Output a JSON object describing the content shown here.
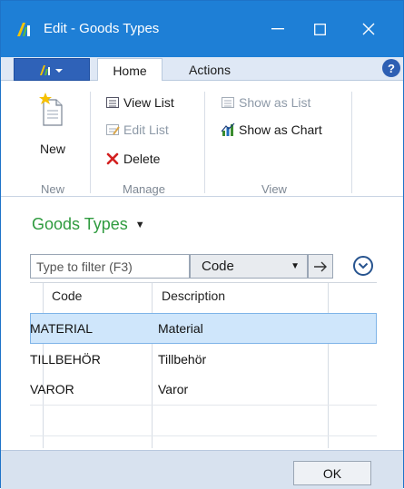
{
  "window": {
    "title": "Edit - Goods Types",
    "accent_color": "#1e7fd6",
    "controls": [
      "minimize-icon",
      "maximize-icon",
      "close-icon"
    ]
  },
  "ribbon": {
    "tabs": [
      {
        "label": "Home",
        "active": true
      },
      {
        "label": "Actions",
        "active": false
      }
    ],
    "groups": [
      {
        "label": "New",
        "items": [
          {
            "label": "New",
            "icon": "new-document-icon",
            "enabled": true
          }
        ]
      },
      {
        "label": "Manage",
        "items": [
          {
            "label": "View List",
            "icon": "view-list-icon",
            "enabled": true
          },
          {
            "label": "Edit List",
            "icon": "edit-list-icon",
            "enabled": false
          },
          {
            "label": "Delete",
            "icon": "delete-icon",
            "enabled": true
          }
        ]
      },
      {
        "label": "View",
        "items": [
          {
            "label": "Show as List",
            "icon": "show-as-list-icon",
            "enabled": false
          },
          {
            "label": "Show as Chart",
            "icon": "show-as-chart-icon",
            "enabled": true
          }
        ]
      }
    ]
  },
  "page": {
    "title": "Goods Types",
    "title_color": "#2f9b3f",
    "filter": {
      "placeholder": "Type to filter (F3)",
      "field": "Code"
    }
  },
  "grid": {
    "columns": [
      "Code",
      "Description"
    ],
    "rows": [
      {
        "code": "MATERIAL",
        "description": "Material",
        "selected": true
      },
      {
        "code": "TILLBEHÖR",
        "description": "Tillbehör",
        "selected": false
      },
      {
        "code": "VAROR",
        "description": "Varor",
        "selected": false
      }
    ]
  },
  "footer": {
    "ok_label": "OK"
  }
}
